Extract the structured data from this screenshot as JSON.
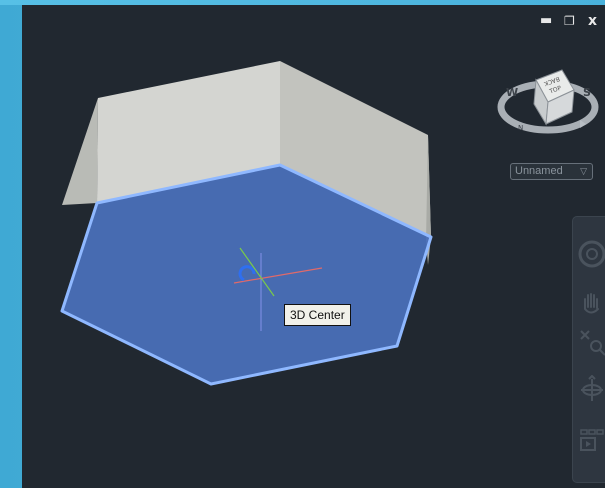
{
  "window": {
    "minimize_glyph": "▬",
    "restore_glyph": "❐",
    "close_glyph": "x"
  },
  "viewcube": {
    "top_face_label": "TOP",
    "back_face_label": "BACK",
    "compass_w": "W",
    "compass_s": "S",
    "compass_n": "N"
  },
  "named_view": {
    "label": "Unnamed",
    "chevron": "▽"
  },
  "tooltip": {
    "text": "3D Center"
  },
  "colors": {
    "viewport_bg": "#212830",
    "selection_fill": "#4a6fb8",
    "selection_edge": "#8fb8ff",
    "frame_accent": "#45b0da"
  },
  "navbar_icons": [
    "steering-wheel-icon",
    "pan-icon",
    "zoom-extents-icon",
    "orbit-icon",
    "showmotion-icon"
  ]
}
